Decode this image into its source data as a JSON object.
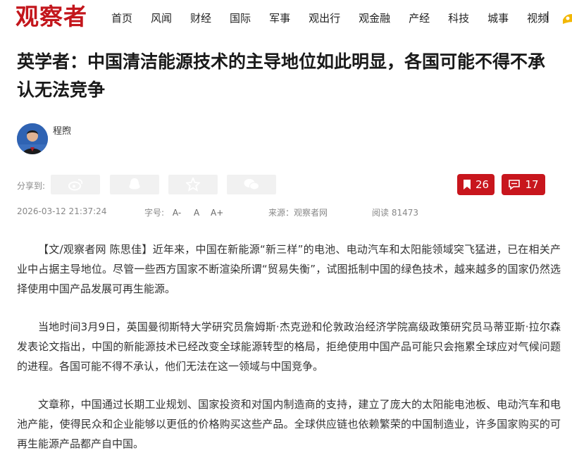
{
  "header": {
    "logo": "观察者",
    "nav": [
      "首页",
      "风闻",
      "财经",
      "国际",
      "军事",
      "观出行",
      "观金融",
      "产经",
      "科技",
      "城事",
      "视频"
    ],
    "divider": "|"
  },
  "article": {
    "title": "英学者：中国清洁能源技术的主导地位如此明显，各国可能不得不承认无法竞争",
    "author": "程煦",
    "share_label": "分享到:",
    "share_icons": [
      "weibo-icon",
      "qq-icon",
      "qzone-icon",
      "wechat-icon"
    ],
    "bookmark_count": "26",
    "comment_count": "17",
    "date": "2026-03-12 21:37:24",
    "font_size_label": "字号:",
    "font_sizes": [
      "A-",
      "A",
      "A+"
    ],
    "source": "来源：观察者网",
    "views": "阅读 81473",
    "paragraphs": [
      "【文/观察者网 陈思佳】近年来，中国在新能源“新三样”的电池、电动汽车和太阳能领域突飞猛进，已在相关产业中占据主导地位。尽管一些西方国家不断渲染所谓“贸易失衡”，试图抵制中国的绿色技术，越来越多的国家仍然选择使用中国产品发展可再生能源。",
      "当地时间3月9日，英国曼彻斯特大学研究员詹姆斯·杰克逊和伦敦政治经济学院高级政策研究员马蒂亚斯·拉尔森发表论文指出，中国的新能源技术已经改变全球能源转型的格局，拒绝使用中国产品可能只会拖累全球应对气候问题的进程。各国可能不得不承认，他们无法在这一领域与中国竞争。",
      "文章称，中国通过长期工业规划、国家投资和对国内制造商的支持，建立了庞大的太阳能电池板、电动汽车和电池产能，使得民众和企业能够以更低的价格购买这些产品。全球供应链也依赖繁荣的中国制造业，许多国家购买的可再生能源产品都产自中国。"
    ]
  },
  "colors": {
    "brand": "#c3161c",
    "accent": "#c8161d"
  }
}
